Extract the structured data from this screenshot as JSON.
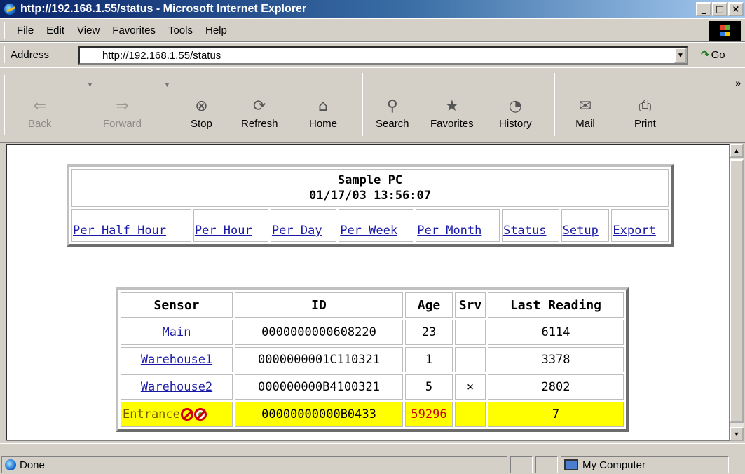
{
  "window": {
    "title": "http://192.168.1.55/status - Microsoft Internet Explorer",
    "controls": [
      "_",
      "□",
      "×"
    ]
  },
  "menu": [
    "File",
    "Edit",
    "View",
    "Favorites",
    "Tools",
    "Help"
  ],
  "address": {
    "label": "Address",
    "url": "http://192.168.1.55/status",
    "go_label": "Go"
  },
  "toolbar": {
    "buttons": [
      {
        "label": "Back",
        "icon": "back-arrow-icon",
        "enabled": false
      },
      {
        "label": "Forward",
        "icon": "forward-arrow-icon",
        "enabled": false
      },
      {
        "label": "Stop",
        "icon": "stop-icon",
        "enabled": true
      },
      {
        "label": "Refresh",
        "icon": "refresh-icon",
        "enabled": true
      },
      {
        "label": "Home",
        "icon": "home-icon",
        "enabled": true
      },
      {
        "label": "Search",
        "icon": "search-icon",
        "enabled": true
      },
      {
        "label": "Favorites",
        "icon": "favorites-icon",
        "enabled": true
      },
      {
        "label": "History",
        "icon": "history-icon",
        "enabled": true
      },
      {
        "label": "Mail",
        "icon": "mail-icon",
        "enabled": true
      },
      {
        "label": "Print",
        "icon": "print-icon",
        "enabled": true
      }
    ]
  },
  "page": {
    "title": "Sample PC",
    "datetime": "01/17/03 13:56:07",
    "nav_links": [
      "Per Half Hour",
      "Per Hour",
      "Per Day",
      "Per Week",
      "Per Month",
      "Status",
      "Setup",
      "Export"
    ],
    "table": {
      "headers": [
        "Sensor",
        "ID",
        "Age",
        "Srv",
        "Last Reading"
      ],
      "rows": [
        {
          "sensor": "Main",
          "id": "0000000000608220",
          "age": "23",
          "srv": "",
          "last_reading": "6114",
          "alert": false
        },
        {
          "sensor": "Warehouse1",
          "id": "0000000001C110321",
          "age": "1",
          "srv": "",
          "last_reading": "3378",
          "alert": false
        },
        {
          "sensor": "Warehouse2",
          "id": "000000000B4100321",
          "age": "5",
          "srv": "×",
          "last_reading": "2802",
          "alert": false
        },
        {
          "sensor": "Entrance",
          "id": "00000000000B0433",
          "age": "59296",
          "srv": "",
          "last_reading": "7",
          "alert": true
        }
      ]
    }
  },
  "status": {
    "text": "Done",
    "zone": "My Computer"
  },
  "colors": {
    "titlebar_start": "#0a246a",
    "link": "#1a1aa6",
    "alert_row": "#ffff00",
    "alert_text": "#d00000"
  }
}
